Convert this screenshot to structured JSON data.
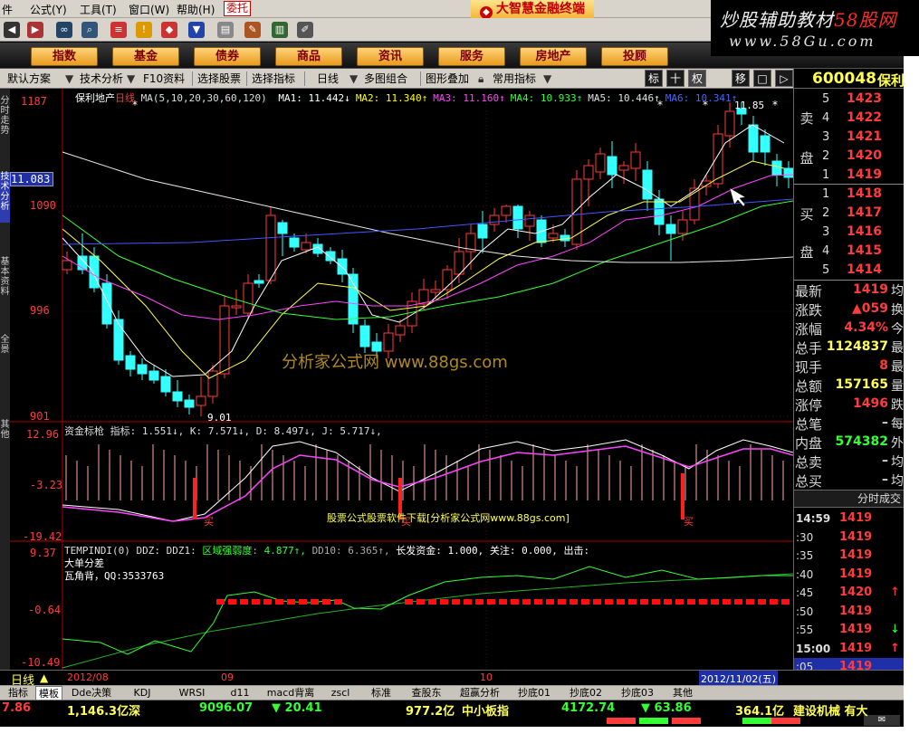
{
  "menu": {
    "items": [
      "件",
      "公式(Y)",
      "工具(T)",
      "窗口(W)",
      "帮助(H)"
    ],
    "trade_button": "委托",
    "app_title": "大智慧金融终端"
  },
  "watermark": {
    "line1_prefix": "炒股辅助教材",
    "line1_brand": "58股网",
    "line2": "www.58Gu.com"
  },
  "toolbar": {
    "icons": [
      "back-icon",
      "forward-icon",
      "binoculars-icon",
      "search-icon",
      "notepad-icon",
      "alarm-icon",
      "diamond-icon",
      "down-arrow-icon",
      "globe-icon",
      "printer-icon",
      "chat-icon",
      "books-icon",
      "pencil-icon"
    ]
  },
  "nav": {
    "buttons": [
      "指数",
      "基金",
      "债券",
      "商品",
      "资讯",
      "服务",
      "房地产",
      "投顾"
    ]
  },
  "bar2": {
    "items": [
      "默认方案",
      "技术分析",
      "F10资料",
      "选择股票",
      "选择指标",
      "日线",
      "多图组合",
      "图形叠加",
      "常用指标"
    ],
    "right_tabs": [
      "标",
      "十",
      "权",
      "移",
      "□",
      "▷"
    ],
    "workarea_label": "工作区"
  },
  "left_tabs": [
    {
      "label": "分时走势",
      "active": false
    },
    {
      "label": "技术分析",
      "active": true
    },
    {
      "label": "基本资料",
      "active": false
    },
    {
      "label": "全景",
      "active": false
    },
    {
      "label": "其他",
      "active": false
    }
  ],
  "main_pane": {
    "stock_name": "保利地产",
    "period": "日线",
    "ma_params": "MA(5,10,20,30,60,120)",
    "ma_values": [
      {
        "label": "MA1:",
        "value": "11.442↓",
        "color": "#ffffff"
      },
      {
        "label": "MA2:",
        "value": "11.340↑",
        "color": "#ffff00"
      },
      {
        "label": "MA3:",
        "value": "11.160↑",
        "color": "#ff44ff"
      },
      {
        "label": "MA4:",
        "value": "10.933↑",
        "color": "#33ff33"
      },
      {
        "label": "MA5:",
        "value": "10.446↑",
        "color": "#e0e0e0"
      },
      {
        "label": "MA6:",
        "value": "10.341↑",
        "color": "#4466ff"
      }
    ],
    "y_ticks": [
      "1187",
      "1090",
      "996",
      "901"
    ],
    "cursor_price": "11.083",
    "high_label": "11.85",
    "low_label": "9.01",
    "watermark_text": "分析家公式网 www.88gs.com"
  },
  "kdj_pane": {
    "title": "资金标枪 指标: 1.551↓, K: 7.571↓, D: 8.497↓, J: 5.717↓,",
    "y_ticks": [
      "12.96",
      "-3.23",
      "-19.42"
    ],
    "signals": [
      "买",
      "买",
      "买"
    ],
    "note": "股票公式股票软件下载[分析家公式网www.88gs.com]"
  },
  "ddz_pane": {
    "title_a": "TEMPINDI(0) DDZ: DDZ1:",
    "title_b": "区域强弱度: 4.877↑,",
    "title_c": "DD10: 6.365↑,",
    "title_d": "长发资金: 1.000, 关注: 0.000, 出击:",
    "line2": "大单分差",
    "line3": "瓦角背，QQ:3533763",
    "y_ticks": [
      "9.37",
      "-0.64",
      "-10.49"
    ]
  },
  "quote": {
    "code": "600048",
    "name": "保利",
    "sell_side_label": [
      "卖",
      "盘"
    ],
    "buy_side_label": [
      "买",
      "盘"
    ],
    "asks": [
      {
        "level": "5",
        "price": "1423"
      },
      {
        "level": "4",
        "price": "1422"
      },
      {
        "level": "3",
        "price": "1421"
      },
      {
        "level": "2",
        "price": "1420"
      },
      {
        "level": "1",
        "price": "1419"
      }
    ],
    "bids": [
      {
        "level": "1",
        "price": "1418"
      },
      {
        "level": "2",
        "price": "1417"
      },
      {
        "level": "3",
        "price": "1416"
      },
      {
        "level": "4",
        "price": "1415"
      },
      {
        "level": "5",
        "price": "1414"
      }
    ],
    "stats": [
      {
        "k": "最新",
        "v": "1419",
        "x": "均",
        "color": "#ff3b3b"
      },
      {
        "k": "涨跌",
        "v": "▲059",
        "x": "换",
        "color": "#ff3b3b"
      },
      {
        "k": "涨幅",
        "v": "4.34%",
        "x": "今",
        "color": "#ff3b3b"
      },
      {
        "k": "总手",
        "v": "1124837",
        "x": "最",
        "color": "#ffff55"
      },
      {
        "k": "现手",
        "v": "8",
        "x": "最",
        "color": "#ff3b3b"
      },
      {
        "k": "总额",
        "v": "157165",
        "x": "量",
        "color": "#ffff55"
      },
      {
        "k": "涨停",
        "v": "1496",
        "x": "跌",
        "color": "#ff3b3b"
      },
      {
        "k": "总笔",
        "v": "–",
        "x": "每",
        "color": "#d8d8d8"
      },
      {
        "k": "内盘",
        "v": "574382",
        "x": "外",
        "color": "#33ff33"
      },
      {
        "k": "总卖",
        "v": "–",
        "x": "均",
        "color": "#d8d8d8"
      },
      {
        "k": "总买",
        "v": "–",
        "x": "均",
        "color": "#d8d8d8"
      }
    ],
    "trade_header": "分时成交",
    "trades": [
      {
        "t": "14:59",
        "p": "1419",
        "a": "",
        "ac": "#ff3b3b"
      },
      {
        "t": ":30",
        "p": "1419",
        "a": "",
        "ac": "#ff3b3b"
      },
      {
        "t": ":35",
        "p": "1419",
        "a": "",
        "ac": "#ff3b3b"
      },
      {
        "t": ":40",
        "p": "1419",
        "a": "",
        "ac": "#ff3b3b"
      },
      {
        "t": ":45",
        "p": "1420",
        "a": "↑",
        "ac": "#ff3b3b"
      },
      {
        "t": ":50",
        "p": "1419",
        "a": "",
        "ac": "#ff3b3b"
      },
      {
        "t": ":55",
        "p": "1419",
        "a": "↓",
        "ac": "#33ff33"
      },
      {
        "t": "15:00",
        "p": "1419",
        "a": "↑",
        "ac": "#ff3b3b"
      },
      {
        "t": ":05",
        "p": "1419",
        "a": "",
        "ac": "#ff3b3b"
      }
    ]
  },
  "period_bar": {
    "label": "日线",
    "dates": [
      "2012/08",
      "09",
      "10"
    ],
    "cursor_date": "2012/11/02(五)"
  },
  "bottom_tabs": [
    "指标",
    "模板",
    "Dde决策",
    "KDJ",
    "WRSI",
    "d11",
    "macd背离",
    "zscl",
    "标准",
    "查股东",
    "超赢分析",
    "抄底01",
    "抄底02",
    "抄底03",
    "其他"
  ],
  "status": {
    "items": [
      {
        "text": "7.86",
        "color": "#ff3b3b"
      },
      {
        "text": "1,146.3亿",
        "color": "#ffff55"
      },
      {
        "text": "深",
        "color": "#ffff55"
      },
      {
        "text": "9096.07",
        "color": "#33ff33"
      },
      {
        "text": "▼ 20.41",
        "color": "#33ff33"
      },
      {
        "text": "977.2亿",
        "color": "#ffff55"
      },
      {
        "text": "中小板指",
        "color": "#ffff55"
      },
      {
        "text": "4172.74",
        "color": "#33ff33"
      },
      {
        "text": "▼ 63.86",
        "color": "#33ff33"
      },
      {
        "text": "364.1亿",
        "color": "#ffff55"
      },
      {
        "text": "建设机械 有大",
        "color": "#ffff55"
      }
    ]
  },
  "colors": {
    "bg": "#000000",
    "up_candle": "#ff3b3b",
    "down_candle": "#33ffff",
    "accent_yellow": "#ffff55",
    "grid_red": "#b00000"
  }
}
